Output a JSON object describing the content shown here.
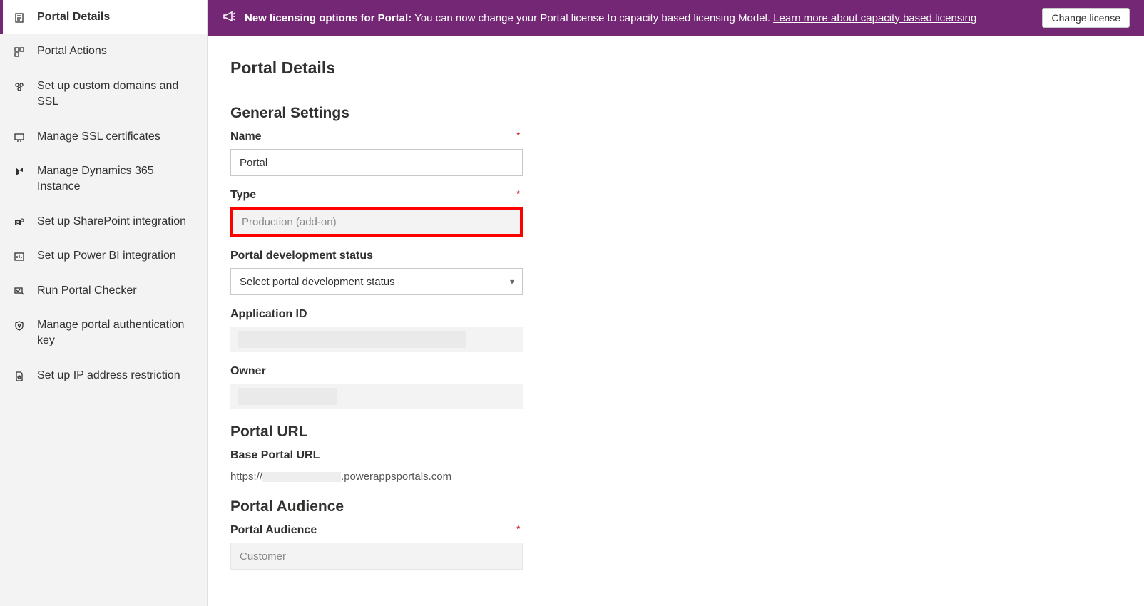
{
  "sidebar": {
    "items": [
      {
        "label": "Portal Details",
        "name": "sidebar-item-portal-details",
        "icon": "document"
      },
      {
        "label": "Portal Actions",
        "name": "sidebar-item-portal-actions",
        "icon": "actions"
      },
      {
        "label": "Set up custom domains and SSL",
        "name": "sidebar-item-custom-domains",
        "icon": "domains"
      },
      {
        "label": "Manage SSL certificates",
        "name": "sidebar-item-ssl-certificates",
        "icon": "certificate"
      },
      {
        "label": "Manage Dynamics 365 Instance",
        "name": "sidebar-item-dynamics-instance",
        "icon": "dynamics"
      },
      {
        "label": "Set up SharePoint integration",
        "name": "sidebar-item-sharepoint",
        "icon": "sharepoint"
      },
      {
        "label": "Set up Power BI integration",
        "name": "sidebar-item-powerbi",
        "icon": "powerbi"
      },
      {
        "label": "Run Portal Checker",
        "name": "sidebar-item-portal-checker",
        "icon": "checker"
      },
      {
        "label": "Manage portal authentication key",
        "name": "sidebar-item-auth-key",
        "icon": "shield"
      },
      {
        "label": "Set up IP address restriction",
        "name": "sidebar-item-ip-restriction",
        "icon": "restriction"
      }
    ]
  },
  "banner": {
    "title": "New licensing options for Portal:",
    "text": "You can now change your Portal license to capacity based licensing Model.",
    "link": "Learn more about capacity based licensing",
    "button": "Change license"
  },
  "page": {
    "title": "Portal Details"
  },
  "sections": {
    "general": {
      "title": "General Settings",
      "name_label": "Name",
      "name_value": "Portal",
      "type_label": "Type",
      "type_value": "Production (add-on)",
      "status_label": "Portal development status",
      "status_placeholder": "Select portal development status",
      "appid_label": "Application ID",
      "owner_label": "Owner"
    },
    "url": {
      "title": "Portal URL",
      "base_label": "Base Portal URL",
      "url_prefix": "https://",
      "url_suffix": ".powerappsportals.com"
    },
    "audience": {
      "title": "Portal Audience",
      "label": "Portal Audience",
      "value": "Customer"
    }
  }
}
